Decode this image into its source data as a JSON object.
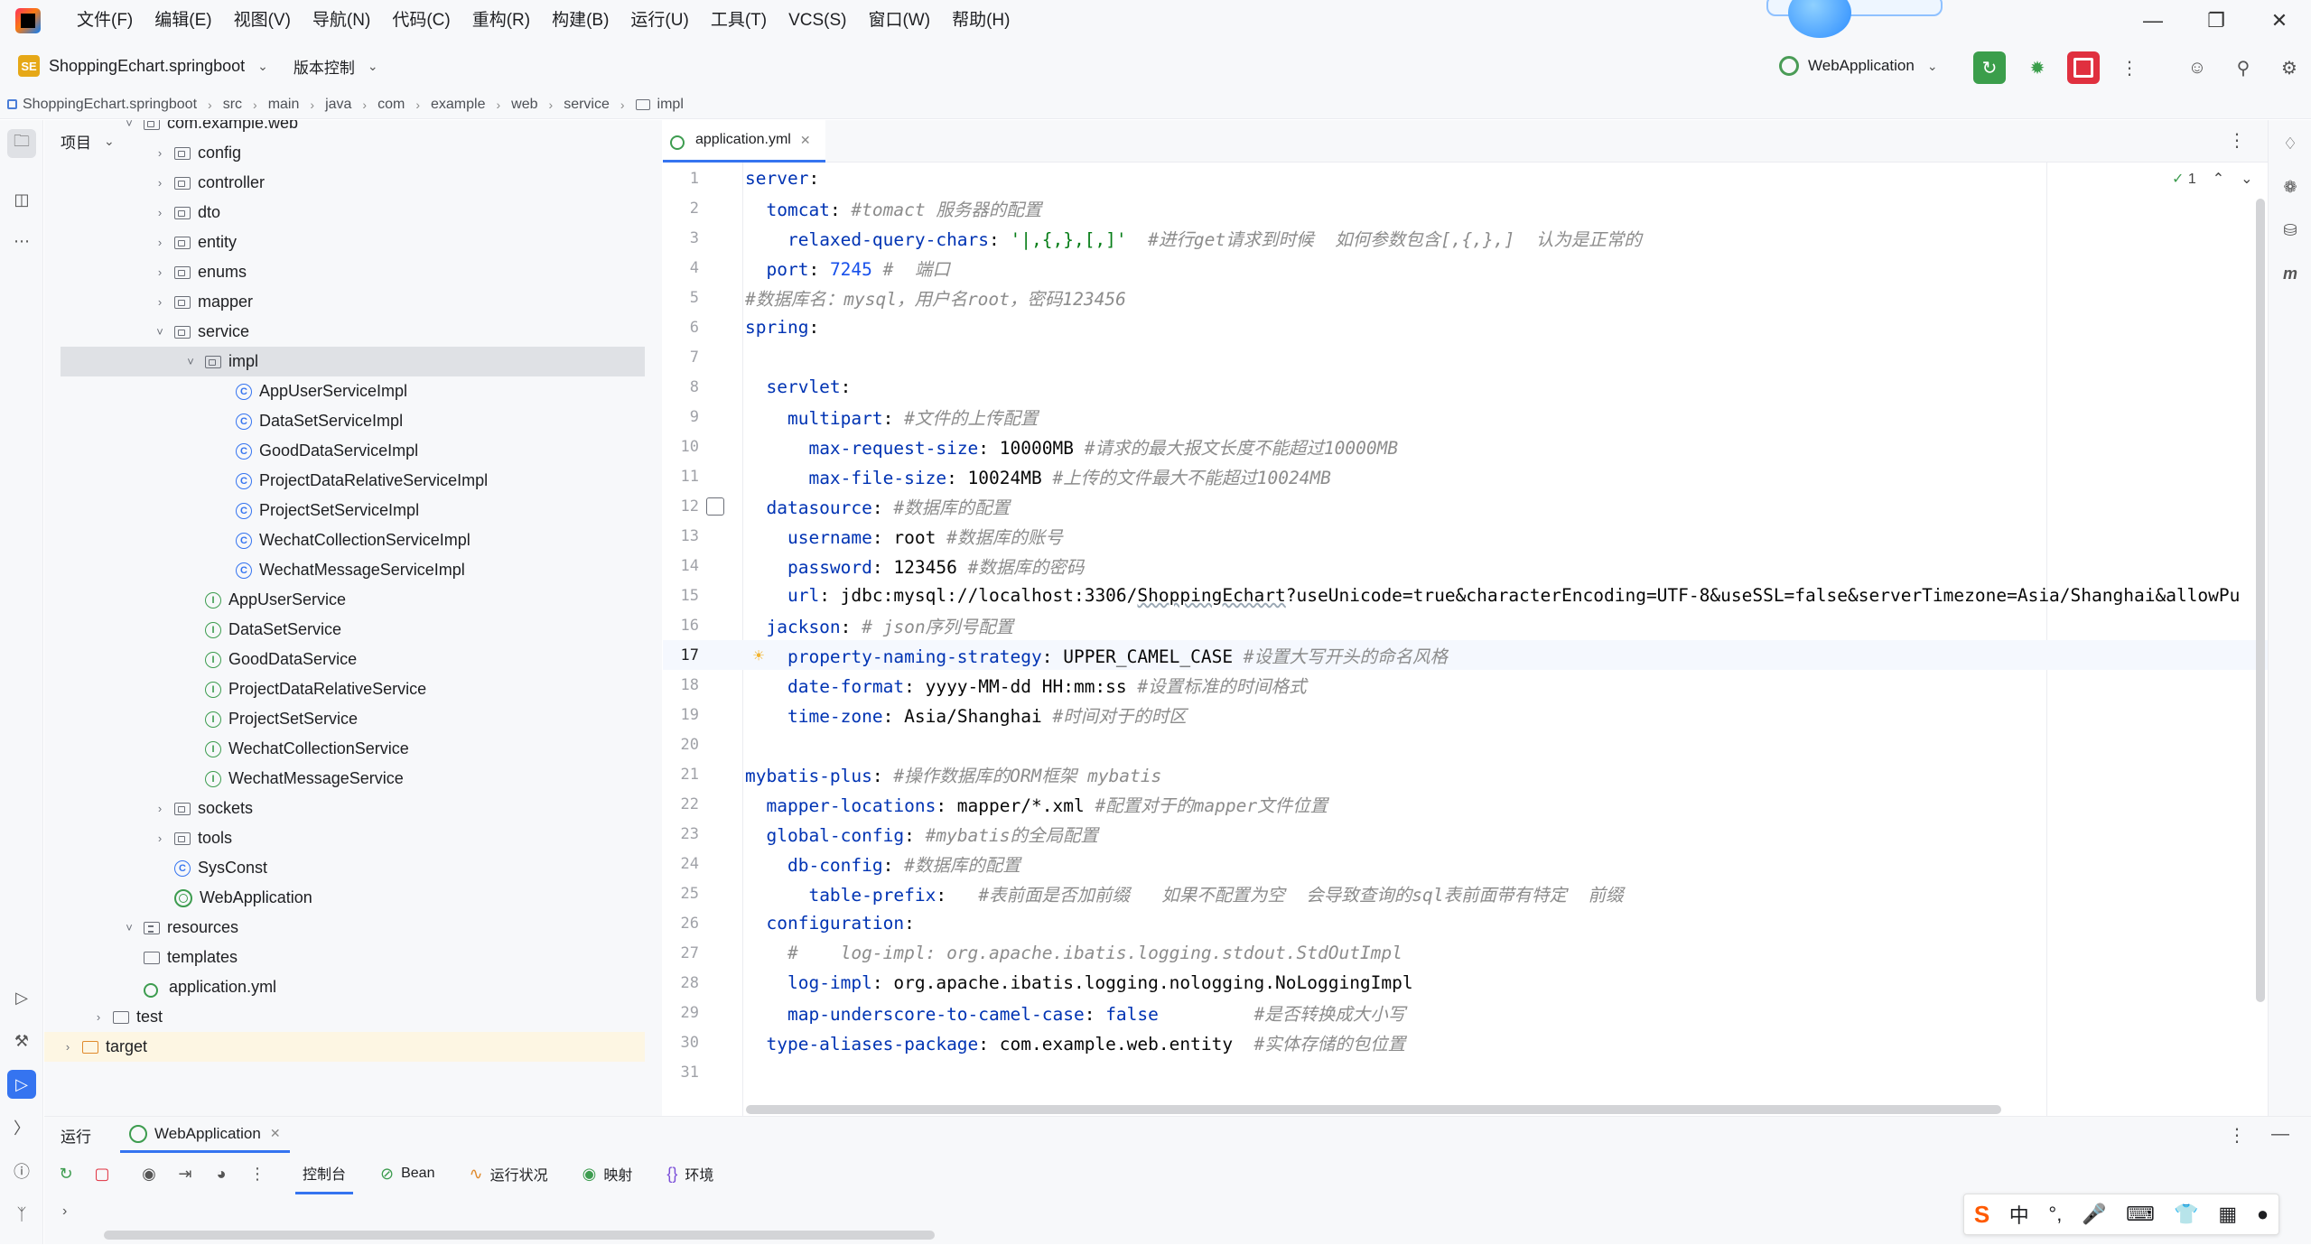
{
  "menu": [
    "文件(F)",
    "编辑(E)",
    "视图(V)",
    "导航(N)",
    "代码(C)",
    "重构(R)",
    "构建(B)",
    "运行(U)",
    "工具(T)",
    "VCS(S)",
    "窗口(W)",
    "帮助(H)"
  ],
  "toolbar": {
    "project_badge": "SE",
    "project_name": "ShoppingEchart.springboot",
    "vcs_label": "版本控制",
    "run_config": "WebApplication"
  },
  "breadcrumb": [
    "ShoppingEchart.springboot",
    "src",
    "main",
    "java",
    "com",
    "example",
    "web",
    "service",
    "impl"
  ],
  "project_panel": {
    "title": "项目",
    "tree": [
      {
        "label": "com.example.web",
        "type": "package",
        "expanded": true
      },
      {
        "label": "config",
        "type": "package",
        "expanded": false
      },
      {
        "label": "controller",
        "type": "package",
        "expanded": false
      },
      {
        "label": "dto",
        "type": "package",
        "expanded": false
      },
      {
        "label": "entity",
        "type": "package",
        "expanded": false
      },
      {
        "label": "enums",
        "type": "package",
        "expanded": false
      },
      {
        "label": "mapper",
        "type": "package",
        "expanded": false
      },
      {
        "label": "service",
        "type": "package",
        "expanded": true
      },
      {
        "label": "impl",
        "type": "package",
        "expanded": true,
        "selected": true
      },
      {
        "label": "AppUserServiceImpl",
        "type": "class"
      },
      {
        "label": "DataSetServiceImpl",
        "type": "class"
      },
      {
        "label": "GoodDataServiceImpl",
        "type": "class"
      },
      {
        "label": "ProjectDataRelativeServiceImpl",
        "type": "class"
      },
      {
        "label": "ProjectSetServiceImpl",
        "type": "class"
      },
      {
        "label": "WechatCollectionServiceImpl",
        "type": "class"
      },
      {
        "label": "WechatMessageServiceImpl",
        "type": "class"
      },
      {
        "label": "AppUserService",
        "type": "interface"
      },
      {
        "label": "DataSetService",
        "type": "interface"
      },
      {
        "label": "GoodDataService",
        "type": "interface"
      },
      {
        "label": "ProjectDataRelativeService",
        "type": "interface"
      },
      {
        "label": "ProjectSetService",
        "type": "interface"
      },
      {
        "label": "WechatCollectionService",
        "type": "interface"
      },
      {
        "label": "WechatMessageService",
        "type": "interface"
      },
      {
        "label": "sockets",
        "type": "package",
        "expanded": false
      },
      {
        "label": "tools",
        "type": "package",
        "expanded": false
      },
      {
        "label": "SysConst",
        "type": "class"
      },
      {
        "label": "WebApplication",
        "type": "spring"
      },
      {
        "label": "resources",
        "type": "resources",
        "expanded": true
      },
      {
        "label": "templates",
        "type": "folder"
      },
      {
        "label": "application.yml",
        "type": "yml"
      },
      {
        "label": "test",
        "type": "folder",
        "expanded": false
      },
      {
        "label": "target",
        "type": "excluded",
        "expanded": false
      }
    ]
  },
  "editor": {
    "tab": "application.yml",
    "inspection_count": "1",
    "current_line": 17,
    "lines": [
      [
        [
          "k",
          "server"
        ],
        [
          "t",
          ":"
        ]
      ],
      [
        [
          "t",
          "  "
        ],
        [
          "k",
          "tomcat"
        ],
        [
          "t",
          ": "
        ],
        [
          "c",
          "#tomact 服务器的配置"
        ]
      ],
      [
        [
          "t",
          "    "
        ],
        [
          "k",
          "relaxed-query-chars"
        ],
        [
          "t",
          ": "
        ],
        [
          "s",
          "'|,{,},[,]'"
        ],
        [
          "t",
          "  "
        ],
        [
          "c",
          "#进行get请求到时候  如何参数包含[,{,},]  认为是正常的"
        ]
      ],
      [
        [
          "t",
          "  "
        ],
        [
          "k",
          "port"
        ],
        [
          "t",
          ": "
        ],
        [
          "v",
          "7245"
        ],
        [
          "t",
          " "
        ],
        [
          "c",
          "#  端口"
        ]
      ],
      [
        [
          "c",
          "#数据库名：mysql，用户名root，密码123456"
        ]
      ],
      [
        [
          "k",
          "spring"
        ],
        [
          "t",
          ":"
        ]
      ],
      [],
      [
        [
          "t",
          "  "
        ],
        [
          "k",
          "servlet"
        ],
        [
          "t",
          ":"
        ]
      ],
      [
        [
          "t",
          "    "
        ],
        [
          "k",
          "multipart"
        ],
        [
          "t",
          ": "
        ],
        [
          "c",
          "#文件的上传配置"
        ]
      ],
      [
        [
          "t",
          "      "
        ],
        [
          "k",
          "max-request-size"
        ],
        [
          "t",
          ": 10000MB "
        ],
        [
          "c",
          "#请求的最大报文长度不能超过10000MB"
        ]
      ],
      [
        [
          "t",
          "      "
        ],
        [
          "k",
          "max-file-size"
        ],
        [
          "t",
          ": 10024MB "
        ],
        [
          "c",
          "#上传的文件最大不能超过10024MB"
        ]
      ],
      [
        [
          "t",
          "  "
        ],
        [
          "k",
          "datasource"
        ],
        [
          "t",
          ": "
        ],
        [
          "c",
          "#数据库的配置"
        ]
      ],
      [
        [
          "t",
          "    "
        ],
        [
          "k",
          "username"
        ],
        [
          "t",
          ": root "
        ],
        [
          "c",
          "#数据库的账号"
        ]
      ],
      [
        [
          "t",
          "    "
        ],
        [
          "k",
          "password"
        ],
        [
          "t",
          ": 123456 "
        ],
        [
          "c",
          "#数据库的密码"
        ]
      ],
      [
        [
          "t",
          "    "
        ],
        [
          "k",
          "url"
        ],
        [
          "t",
          ": jdbc:mysql://localhost:3306/"
        ],
        [
          "u",
          "ShoppingEchart"
        ],
        [
          "t",
          "?useUnicode=true&characterEncoding=UTF-8&useSSL=false&serverTimezone=Asia/Shanghai&allowPu"
        ]
      ],
      [
        [
          "t",
          "  "
        ],
        [
          "k",
          "jackson"
        ],
        [
          "t",
          ": "
        ],
        [
          "c",
          "# json序列号配置"
        ]
      ],
      [
        [
          "t",
          "    "
        ],
        [
          "k",
          "property-naming-strategy"
        ],
        [
          "t",
          ": UPPER_CAMEL_CASE "
        ],
        [
          "c",
          "#设置大写开头的命名风格"
        ]
      ],
      [
        [
          "t",
          "    "
        ],
        [
          "k",
          "date-format"
        ],
        [
          "t",
          ": yyyy-MM-dd HH:mm:ss "
        ],
        [
          "c",
          "#设置标准的时间格式"
        ]
      ],
      [
        [
          "t",
          "    "
        ],
        [
          "k",
          "time-zone"
        ],
        [
          "t",
          ": Asia/Shanghai "
        ],
        [
          "c",
          "#时间对于的时区"
        ]
      ],
      [],
      [
        [
          "k",
          "mybatis-plus"
        ],
        [
          "t",
          ": "
        ],
        [
          "c",
          "#操作数据库的ORM框架 mybatis"
        ]
      ],
      [
        [
          "t",
          "  "
        ],
        [
          "k",
          "mapper-locations"
        ],
        [
          "t",
          ": mapper/*.xml "
        ],
        [
          "c",
          "#配置对于的mapper文件位置"
        ]
      ],
      [
        [
          "t",
          "  "
        ],
        [
          "k",
          "global-config"
        ],
        [
          "t",
          ": "
        ],
        [
          "c",
          "#mybatis的全局配置"
        ]
      ],
      [
        [
          "t",
          "    "
        ],
        [
          "k",
          "db-config"
        ],
        [
          "t",
          ": "
        ],
        [
          "c",
          "#数据库的配置"
        ]
      ],
      [
        [
          "t",
          "      "
        ],
        [
          "k",
          "table-prefix"
        ],
        [
          "t",
          ":   "
        ],
        [
          "c",
          "#表前面是否加前缀   如果不配置为空  会导致查询的sql表前面带有特定  前缀"
        ]
      ],
      [
        [
          "t",
          "  "
        ],
        [
          "k",
          "configuration"
        ],
        [
          "t",
          ":"
        ]
      ],
      [
        [
          "t",
          "    "
        ],
        [
          "c",
          "#    log-impl: org.apache.ibatis.logging.stdout.StdOutImpl"
        ]
      ],
      [
        [
          "t",
          "    "
        ],
        [
          "k",
          "log-impl"
        ],
        [
          "t",
          ": org.apache.ibatis.logging.nologging.NoLoggingImpl"
        ]
      ],
      [
        [
          "t",
          "    "
        ],
        [
          "k",
          "map-underscore-to-camel-case"
        ],
        [
          "t",
          ": "
        ],
        [
          "k",
          "false"
        ],
        [
          "t",
          "         "
        ],
        [
          "c",
          "#是否转换成大小写"
        ]
      ],
      [
        [
          "t",
          "  "
        ],
        [
          "k",
          "type-aliases-package"
        ],
        [
          "t",
          ": com.example.web.entity  "
        ],
        [
          "c",
          "#实体存储的包位置"
        ]
      ],
      []
    ]
  },
  "run_panel": {
    "title": "运行",
    "tab": "WebApplication",
    "subtabs": [
      "控制台",
      "Bean",
      "运行状况",
      "映射",
      "环境"
    ]
  },
  "ime": {
    "logo": "S",
    "mode": "中",
    "punct": "°,"
  }
}
